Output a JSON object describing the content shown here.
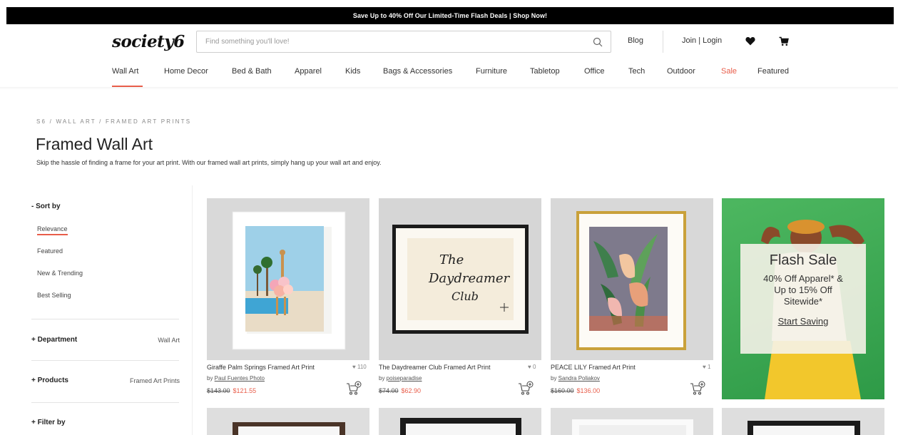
{
  "promo_bar": {
    "text": "Save Up to 40% Off Our Limited-Time Flash Deals | Shop Now!"
  },
  "header": {
    "logo": "society6",
    "search_placeholder": "Find something you'll love!",
    "blog": "Blog",
    "join_login": "Join | Login"
  },
  "nav": {
    "items": [
      {
        "label": "Wall Art"
      },
      {
        "label": "Home Decor"
      },
      {
        "label": "Bed & Bath"
      },
      {
        "label": "Apparel"
      },
      {
        "label": "Kids"
      },
      {
        "label": "Bags & Accessories"
      },
      {
        "label": "Furniture"
      },
      {
        "label": "Tabletop"
      },
      {
        "label": "Office"
      },
      {
        "label": "Tech"
      },
      {
        "label": "Outdoor"
      },
      {
        "label": "Sale"
      },
      {
        "label": "Featured"
      }
    ],
    "active": "Wall Art"
  },
  "breadcrumb": "S6 / WALL ART / FRAMED ART PRINTS",
  "page": {
    "title": "Framed Wall Art",
    "description": "Skip the hassle of finding a frame for your art print. With our framed wall art prints, simply hang up your wall art and enjoy."
  },
  "sidebar": {
    "sort_heading": "- Sort by",
    "sort_options": [
      {
        "label": "Relevance",
        "active": true
      },
      {
        "label": "Featured",
        "active": false
      },
      {
        "label": "New & Trending",
        "active": false
      },
      {
        "label": "Best Selling",
        "active": false
      }
    ],
    "facets": [
      {
        "label": "+ Department",
        "value": "Wall Art"
      },
      {
        "label": "+ Products",
        "value": "Framed Art Prints"
      },
      {
        "label": "+ Filter by",
        "value": ""
      }
    ]
  },
  "products": [
    {
      "title": "Giraffe Palm Springs Framed Art Print",
      "likes": "♥ 110",
      "artist_prefix": "by ",
      "artist": "Paul Fuentes Photo",
      "price_old": "$143.00",
      "price_new": "$121.55"
    },
    {
      "title": "The Daydreamer Club Framed Art Print",
      "likes": "♥ 0",
      "artist_prefix": "by ",
      "artist": "poiseparadise",
      "price_old": "$74.00",
      "price_new": "$62.90"
    },
    {
      "title": "PEACE LILY Framed Art Print",
      "likes": "♥ 1",
      "artist_prefix": "by ",
      "artist": "Sandra Poliakov",
      "price_old": "$160.00",
      "price_new": "$136.00"
    }
  ],
  "artwork_text": {
    "daydreamer": [
      "The",
      "Daydreamer",
      "Club"
    ]
  },
  "flash_sale": {
    "heading": "Flash Sale",
    "line1": "40% Off Apparel* &",
    "line2": "Up to 15% Off",
    "line3": "Sitewide*",
    "cta": "Start Saving"
  },
  "colors": {
    "accent": "#e85d4a",
    "promo_bg": "#000000",
    "flash_green": "#3aa552"
  }
}
